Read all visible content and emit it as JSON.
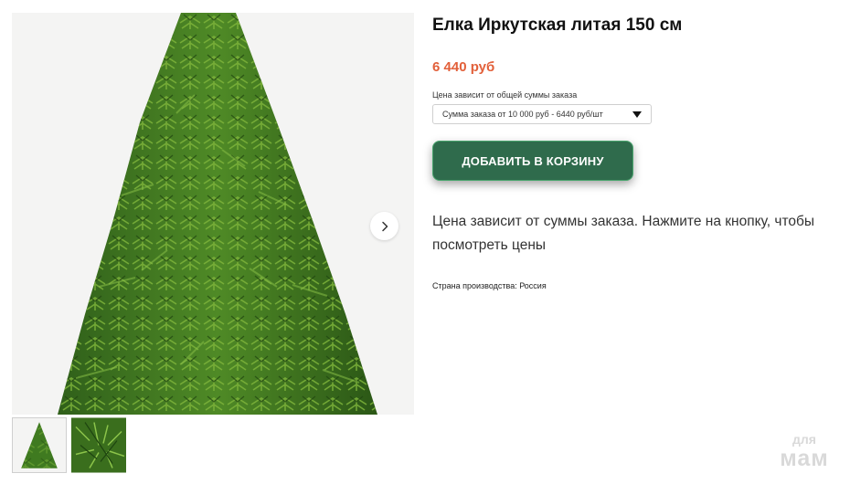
{
  "product": {
    "title": "Елка Иркутская литая 150 см",
    "price": "6 440 руб",
    "select_label": "Цена зависит от общей суммы заказа",
    "select_value": "Сумма заказа от 10 000 руб - 6440 руб/шт",
    "add_to_cart_label": "ДОБАВИТЬ В КОРЗИНУ",
    "description": "Цена зависит от суммы заказа. Нажмите на кнопку, чтобы посмотреть цены",
    "country": "Страна производства: Россия"
  },
  "gallery": {
    "image_subject": "artificial christmas tree",
    "thumbnail_count": 2,
    "next_icon": "chevron-right-icon"
  },
  "watermark": {
    "top": "для",
    "bottom": "мам"
  },
  "colors": {
    "price": "#e2603a",
    "button_bg": "#2f6b4c",
    "tree_dark": "#2c5a18",
    "tree_light": "#6aa02e"
  }
}
